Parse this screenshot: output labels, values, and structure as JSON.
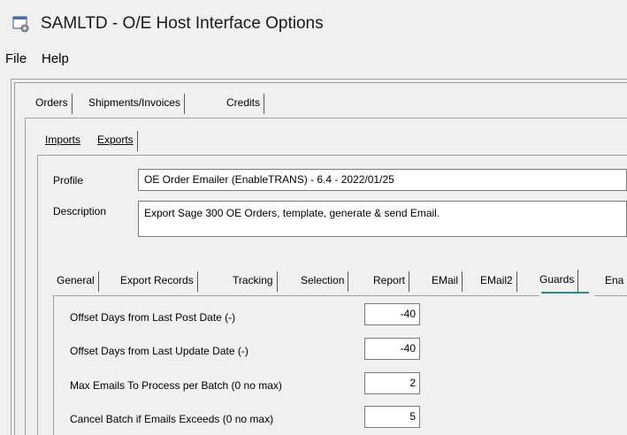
{
  "window": {
    "title": "SAMLTD - O/E Host Interface Options",
    "icon": "app-window-icon"
  },
  "menu": {
    "items": [
      "File",
      "Help"
    ]
  },
  "top_tabs": {
    "items": [
      "Orders",
      "Shipments/Invoices",
      "Credits"
    ],
    "selected": "Orders"
  },
  "sub_tabs": {
    "items": [
      "Imports",
      "Exports"
    ],
    "selected": "Exports"
  },
  "profile": {
    "label": "Profile",
    "value": "OE Order Emailer (EnableTRANS) - 6.4 - 2022/01/25"
  },
  "description": {
    "label": "Description",
    "value": "Export Sage 300 OE Orders, template, generate & send Email."
  },
  "option_tabs": {
    "items": [
      "General",
      "Export Records",
      "Tracking",
      "Selection",
      "Report",
      "EMail",
      "EMail2",
      "Guards",
      "Ena"
    ],
    "selected": "Guards"
  },
  "guards": {
    "fields": [
      {
        "label": "Offset Days from Last Post Date (-)",
        "value": "-40"
      },
      {
        "label": "Offset Days from Last Update Date (-)",
        "value": "-40"
      },
      {
        "label": "Max Emails To Process per Batch  (0 no max)",
        "value": "2"
      },
      {
        "label": "Cancel Batch if Emails Exceeds  (0 no max)",
        "value": "5"
      }
    ]
  },
  "colors": {
    "background": "#f0f0f0",
    "active_tab_accent": "#2c8a8a"
  }
}
